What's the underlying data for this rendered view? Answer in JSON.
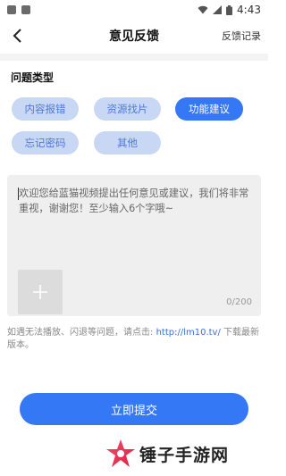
{
  "status_bar": {
    "time": "4:43"
  },
  "header": {
    "title": "意见反馈",
    "history_label": "反馈记录"
  },
  "category": {
    "label": "问题类型",
    "options": [
      "内容报错",
      "资源找片",
      "功能建议",
      "忘记密码",
      "其他"
    ],
    "selected": "功能建议"
  },
  "feedback": {
    "placeholder": "欢迎您给蓝猫视频提出任何意见或建议，我们将非常重视，谢谢您！至少输入6个字哦~",
    "counter": "0/200"
  },
  "hint": {
    "text": "如遇无法播放、闪退等问题，请点击: ",
    "link": "http://lm10.tv/",
    "suffix": " 下载最新版本。"
  },
  "submit_label": "立即提交",
  "watermark": {
    "text": "锤子手游网"
  },
  "colors": {
    "accent": "#3478f6",
    "chip_inactive": "#c8d7f3",
    "chip_inactive_text": "#4e79d6"
  }
}
